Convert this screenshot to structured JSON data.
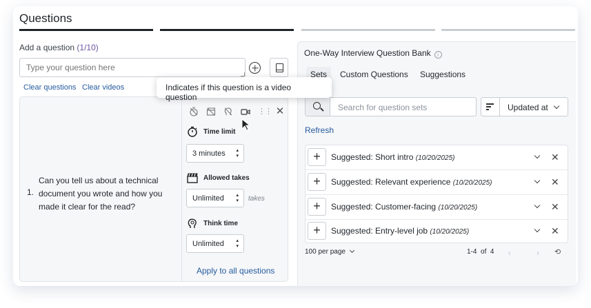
{
  "page": {
    "title": "Questions"
  },
  "progress": {
    "steps": [
      {
        "state": "complete",
        "color": "#1f2328"
      },
      {
        "state": "complete",
        "color": "#1f2328"
      },
      {
        "state": "pending",
        "color": "#c9cdd2"
      },
      {
        "state": "pending",
        "color": "#c9cdd2"
      }
    ]
  },
  "add_question": {
    "label": "Add a question",
    "count": "(1/10)",
    "placeholder": "Type your question here",
    "clear_questions": "Clear questions",
    "clear_videos": "Clear videos"
  },
  "question": {
    "number": "1.",
    "text": "Can you tell us about a technical document you wrote and how you made it clear for the read?",
    "settings": {
      "time_limit_label": "Time limit",
      "time_limit_value": "3 minutes",
      "allowed_takes_label": "Allowed takes",
      "allowed_takes_value": "Unlimited",
      "takes_suffix": "takes",
      "think_time_label": "Think time",
      "think_time_value": "Unlimited",
      "apply_all": "Apply to all questions"
    }
  },
  "tooltip": {
    "text": "Indicates if this question is a video question"
  },
  "bank": {
    "title": "One-Way Interview Question Bank",
    "tabs": [
      {
        "label": "Sets",
        "active": true
      },
      {
        "label": "Custom Questions",
        "active": false
      },
      {
        "label": "Suggestions",
        "active": false
      }
    ],
    "search_placeholder": "Search for question sets",
    "sort_value": "Updated at",
    "refresh": "Refresh",
    "items": [
      {
        "name": "Suggested: Short intro",
        "date": "(10/20/2025)"
      },
      {
        "name": "Suggested: Relevant experience",
        "date": "(10/20/2025)"
      },
      {
        "name": "Suggested: Customer-facing",
        "date": "(10/20/2025)"
      },
      {
        "name": "Suggested: Entry-level job",
        "date": "(10/20/2025)"
      }
    ],
    "per_page": "100 per page",
    "pager": {
      "range": "1-4",
      "of": "of",
      "total": "4"
    }
  }
}
